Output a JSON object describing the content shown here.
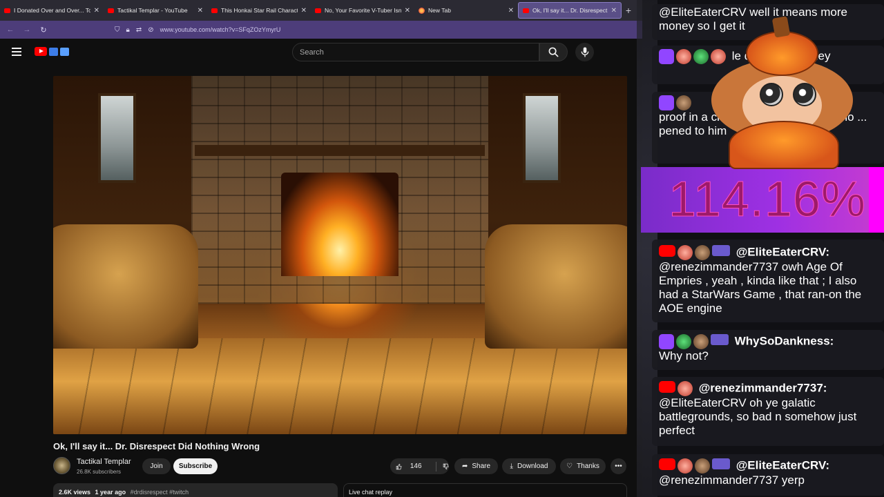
{
  "browser": {
    "tabs": [
      {
        "title": "I Donated Over and Over... To S",
        "favicon": "youtube-icon"
      },
      {
        "title": "Tactikal Templar - YouTube",
        "favicon": "youtube-icon"
      },
      {
        "title": "This Honkai Star Rail Character",
        "favicon": "youtube-icon"
      },
      {
        "title": "No, Your Favorite V-Tuber Isn't",
        "favicon": "youtube-icon"
      },
      {
        "title": "New Tab",
        "favicon": "firefox-icon"
      },
      {
        "title": "Ok, I'll say it... Dr. Disrespect Di",
        "favicon": "youtube-icon",
        "active": true
      }
    ],
    "url": "www.youtube.com/watch?v=SFqZOzYmyrU"
  },
  "youtube": {
    "search_placeholder": "Search",
    "video": {
      "title": "Ok, I'll say it... Dr. Disrespect Did Nothing Wrong",
      "channel": "Tactikal Templar",
      "subscribers": "26.8K subscribers",
      "join_label": "Join",
      "subscribe_label": "Subscribe",
      "likes": "146",
      "share_label": "Share",
      "download_label": "Download",
      "thanks_label": "Thanks",
      "views": "2.6K views",
      "age": "1 year ago",
      "tags": "#drdisrespect #twitch",
      "live_chat_label": "Live chat replay"
    }
  },
  "overlay": {
    "percent": "114.16%",
    "chat": [
      {
        "user": "",
        "text": "@EliteEaterCRV well it means more money so I get it"
      },
      {
        "user": "",
        "text": "le did sue, but they"
      },
      {
        "user": "",
        "text": "proof in a civil ... estiny sexted a mino ... pened to him"
      },
      {
        "user": "@EliteEaterCRV:",
        "text": "@renezimmander7737 owh Age Of Empries , yeah , kinda like that ; I also had a StarWars Game , that ran-on the AOE engine"
      },
      {
        "user": "WhySoDankness:",
        "text": "Why not?"
      },
      {
        "user": "@renezimmander7737:",
        "text": "@EliteEaterCRV oh ye galatic battlegrounds, so bad n somehow just perfect"
      },
      {
        "user": "@EliteEaterCRV:",
        "text": "@renezimmander7737 yerp"
      }
    ]
  }
}
